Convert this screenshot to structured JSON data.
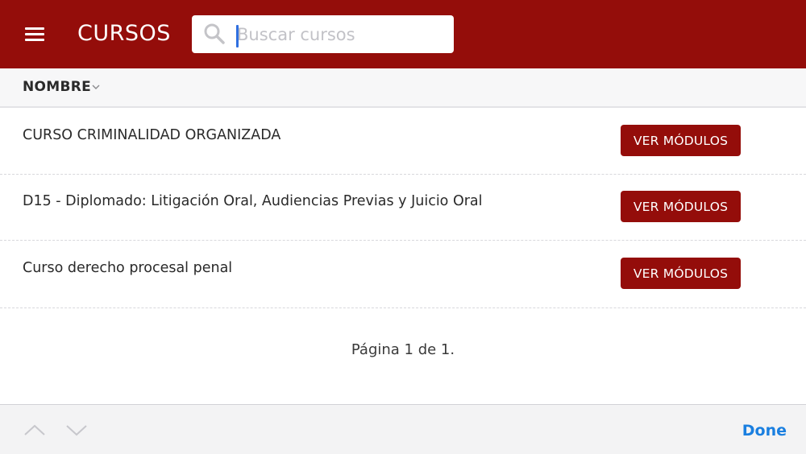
{
  "header": {
    "title": "CURSOS",
    "menu_icon": "hamburger-icon",
    "search": {
      "placeholder": "Buscar cursos",
      "value": "",
      "icon": "search-icon"
    },
    "brand_color": "#940d0a"
  },
  "sort": {
    "label": "NOMBRE",
    "icon": "chevron-down-icon"
  },
  "courses": [
    {
      "name": "CURSO CRIMINALIDAD ORGANIZADA",
      "action_label": "VER MÓDULOS"
    },
    {
      "name": "D15 - Diplomado: Litigación Oral, Audiencias Previas y Juicio Oral",
      "action_label": "VER MÓDULOS"
    },
    {
      "name": "Curso derecho procesal penal",
      "action_label": "VER MÓDULOS"
    }
  ],
  "pagination": {
    "text": "Página 1 de 1."
  },
  "keyboard_toolbar": {
    "prev_icon": "chevron-up-icon",
    "next_icon": "chevron-down-icon",
    "done_label": "Done",
    "done_color": "#1a7fe0"
  }
}
